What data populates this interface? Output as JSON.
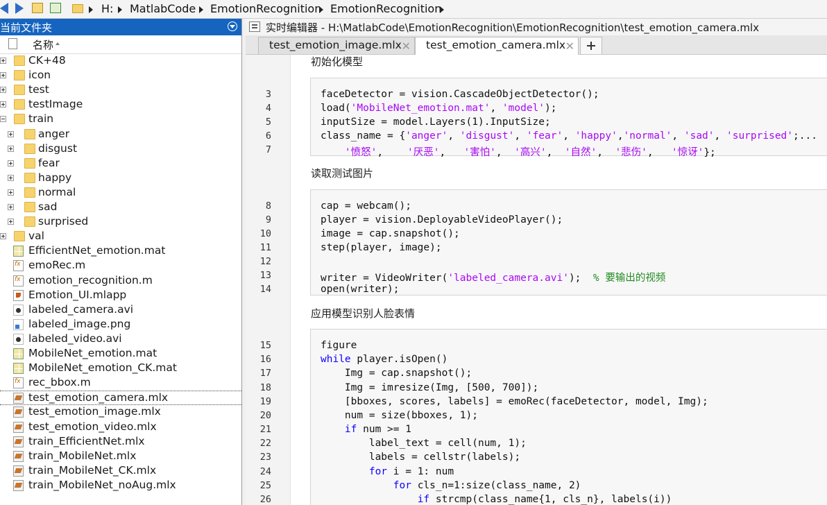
{
  "address_bar": {
    "crumbs": [
      "H:",
      "MatlabCode",
      "EmotionRecognition",
      "EmotionRecognition"
    ]
  },
  "current_folder": {
    "title": "当前文件夹",
    "column_name": "名称",
    "items": [
      {
        "label": "CK+48",
        "type": "folder"
      },
      {
        "label": "icon",
        "type": "folder"
      },
      {
        "label": "test",
        "type": "folder"
      },
      {
        "label": "testImage",
        "type": "folder"
      },
      {
        "label": "train",
        "type": "folder"
      },
      {
        "label": "anger",
        "type": "folder"
      },
      {
        "label": "disgust",
        "type": "folder"
      },
      {
        "label": "fear",
        "type": "folder"
      },
      {
        "label": "happy",
        "type": "folder"
      },
      {
        "label": "normal",
        "type": "folder"
      },
      {
        "label": "sad",
        "type": "folder"
      },
      {
        "label": "surprised",
        "type": "folder"
      },
      {
        "label": "val",
        "type": "folder"
      },
      {
        "label": "EfficientNet_emotion.mat",
        "type": "mat"
      },
      {
        "label": "emoRec.m",
        "type": "m"
      },
      {
        "label": "emotion_recognition.m",
        "type": "m"
      },
      {
        "label": "Emotion_UI.mlapp",
        "type": "mlapp"
      },
      {
        "label": "labeled_camera.avi",
        "type": "avi"
      },
      {
        "label": "labeled_image.png",
        "type": "png"
      },
      {
        "label": "labeled_video.avi",
        "type": "avi"
      },
      {
        "label": "MobileNet_emotion.mat",
        "type": "mat"
      },
      {
        "label": "MobileNet_emotion_CK.mat",
        "type": "mat"
      },
      {
        "label": "rec_bbox.m",
        "type": "m"
      },
      {
        "label": "test_emotion_camera.mlx",
        "type": "mlx",
        "selected": true
      },
      {
        "label": "test_emotion_image.mlx",
        "type": "mlx"
      },
      {
        "label": "test_emotion_video.mlx",
        "type": "mlx"
      },
      {
        "label": "train_EfficientNet.mlx",
        "type": "mlx"
      },
      {
        "label": "train_MobileNet.mlx",
        "type": "mlx"
      },
      {
        "label": "train_MobileNet_CK.mlx",
        "type": "mlx"
      },
      {
        "label": "train_MobileNet_noAug.mlx",
        "type": "mlx"
      }
    ]
  },
  "editor": {
    "title": "实时编辑器 - H:\\MatlabCode\\EmotionRecognition\\EmotionRecognition\\test_emotion_camera.mlx",
    "tabs": [
      {
        "label": "test_emotion_image.mlx",
        "close": "✕",
        "active": false
      },
      {
        "label": "test_emotion_camera.mlx",
        "close": "✕",
        "active": true
      }
    ],
    "sections": [
      "初始化模型",
      "读取测试图片",
      "应用模型识别人脸表情"
    ],
    "lines": [
      {
        "n": "3",
        "tokens": [
          [
            "t",
            "faceDetector = vision.CascadeObjectDetector();"
          ]
        ]
      },
      {
        "n": "4",
        "tokens": [
          [
            "t",
            "load("
          ],
          [
            "s",
            "'MobileNet_emotion.mat'"
          ],
          [
            "t",
            ", "
          ],
          [
            "s",
            "'model'"
          ],
          [
            "t",
            ");"
          ]
        ]
      },
      {
        "n": "5",
        "tokens": [
          [
            "t",
            "inputSize = model.Layers(1).InputSize;"
          ]
        ]
      },
      {
        "n": "6",
        "tokens": [
          [
            "t",
            "class_name = {"
          ],
          [
            "s",
            "'anger'"
          ],
          [
            "t",
            ", "
          ],
          [
            "s",
            "'disgust'"
          ],
          [
            "t",
            ", "
          ],
          [
            "s",
            "'fear'"
          ],
          [
            "t",
            ", "
          ],
          [
            "s",
            "'happy'"
          ],
          [
            "t",
            ","
          ],
          [
            "s",
            "'normal'"
          ],
          [
            "t",
            ", "
          ],
          [
            "s",
            "'sad'"
          ],
          [
            "t",
            ", "
          ],
          [
            "s",
            "'surprised'"
          ],
          [
            "t",
            ";..."
          ]
        ]
      },
      {
        "n": "7",
        "tokens": [
          [
            "t",
            "    "
          ],
          [
            "s",
            "'愤怒'"
          ],
          [
            "t",
            ",    "
          ],
          [
            "s",
            "'厌恶'"
          ],
          [
            "t",
            ",   "
          ],
          [
            "s",
            "'害怕'"
          ],
          [
            "t",
            ",  "
          ],
          [
            "s",
            "'高兴'"
          ],
          [
            "t",
            ",  "
          ],
          [
            "s",
            "'自然'"
          ],
          [
            "t",
            ",  "
          ],
          [
            "s",
            "'悲伤'"
          ],
          [
            "t",
            ",   "
          ],
          [
            "s",
            "'惊讶'"
          ],
          [
            "t",
            "};"
          ]
        ]
      },
      {
        "n": "8",
        "tokens": [
          [
            "t",
            "cap = webcam();"
          ]
        ]
      },
      {
        "n": "9",
        "tokens": [
          [
            "t",
            "player = vision.DeployableVideoPlayer();"
          ]
        ]
      },
      {
        "n": "10",
        "tokens": [
          [
            "t",
            "image = cap.snapshot();"
          ]
        ]
      },
      {
        "n": "11",
        "tokens": [
          [
            "t",
            "step(player, image);"
          ]
        ]
      },
      {
        "n": "12",
        "tokens": []
      },
      {
        "n": "13",
        "tokens": [
          [
            "t",
            "writer = VideoWriter("
          ],
          [
            "s",
            "'labeled_camera.avi'"
          ],
          [
            "t",
            ");  "
          ],
          [
            "c",
            "% 要输出的视频"
          ]
        ]
      },
      {
        "n": "14",
        "tokens": [
          [
            "t",
            "open(writer);"
          ]
        ]
      },
      {
        "n": "15",
        "tokens": [
          [
            "t",
            "figure"
          ]
        ]
      },
      {
        "n": "16",
        "tokens": [
          [
            "k",
            "while"
          ],
          [
            "t",
            " player.isOpen()"
          ]
        ]
      },
      {
        "n": "17",
        "tokens": [
          [
            "t",
            "    Img = cap.snapshot();"
          ]
        ]
      },
      {
        "n": "18",
        "tokens": [
          [
            "t",
            "    Img = imresize(Img, [500, 700]);"
          ]
        ]
      },
      {
        "n": "19",
        "tokens": [
          [
            "t",
            "    [bboxes, scores, labels] = emoRec(faceDetector, model, Img);"
          ]
        ]
      },
      {
        "n": "20",
        "tokens": [
          [
            "t",
            "    num = size(bboxes, 1);"
          ]
        ]
      },
      {
        "n": "21",
        "tokens": [
          [
            "t",
            "    "
          ],
          [
            "k",
            "if"
          ],
          [
            "t",
            " num >= 1"
          ]
        ]
      },
      {
        "n": "22",
        "tokens": [
          [
            "t",
            "        label_text = cell(num, 1);"
          ]
        ]
      },
      {
        "n": "23",
        "tokens": [
          [
            "t",
            "        labels = cellstr(labels);"
          ]
        ]
      },
      {
        "n": "24",
        "tokens": [
          [
            "t",
            "        "
          ],
          [
            "k",
            "for"
          ],
          [
            "t",
            " i = 1: num"
          ]
        ]
      },
      {
        "n": "25",
        "tokens": [
          [
            "t",
            "            "
          ],
          [
            "k",
            "for"
          ],
          [
            "t",
            " cls_n=1:size(class_name, 2)"
          ]
        ]
      },
      {
        "n": "26",
        "tokens": [
          [
            "t",
            "                "
          ],
          [
            "k",
            "if"
          ],
          [
            "t",
            " strcmp(class_name{1, cls_n}, labels(i))"
          ]
        ]
      }
    ]
  },
  "colors": {
    "panel_header": "#1565c0",
    "keyword": "#0e00ff",
    "string": "#a709f5",
    "comment": "#228b22"
  }
}
